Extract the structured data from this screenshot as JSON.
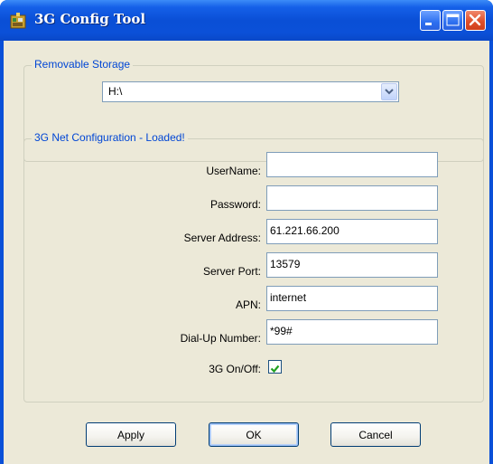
{
  "window": {
    "title": "3G Config Tool"
  },
  "storage": {
    "legend": "Removable Storage",
    "selected": "H:\\"
  },
  "net": {
    "legend": "3G Net Configuration - Loaded!",
    "fields": [
      {
        "label": "UserName:",
        "value": ""
      },
      {
        "label": "Password:",
        "value": ""
      },
      {
        "label": "Server Address:",
        "value": "61.221.66.200"
      },
      {
        "label": "Server Port:",
        "value": "13579"
      },
      {
        "label": "APN:",
        "value": "internet"
      },
      {
        "label": "Dial-Up Number:",
        "value": "*99#"
      }
    ],
    "toggle_label": "3G On/Off:",
    "toggle_checked": true
  },
  "buttons": {
    "apply": "Apply",
    "ok": "OK",
    "cancel": "Cancel"
  },
  "colors": {
    "title_bar": "#0a50d8",
    "legend": "#0046d5",
    "check": "#21a121",
    "close": "#e0502a"
  }
}
